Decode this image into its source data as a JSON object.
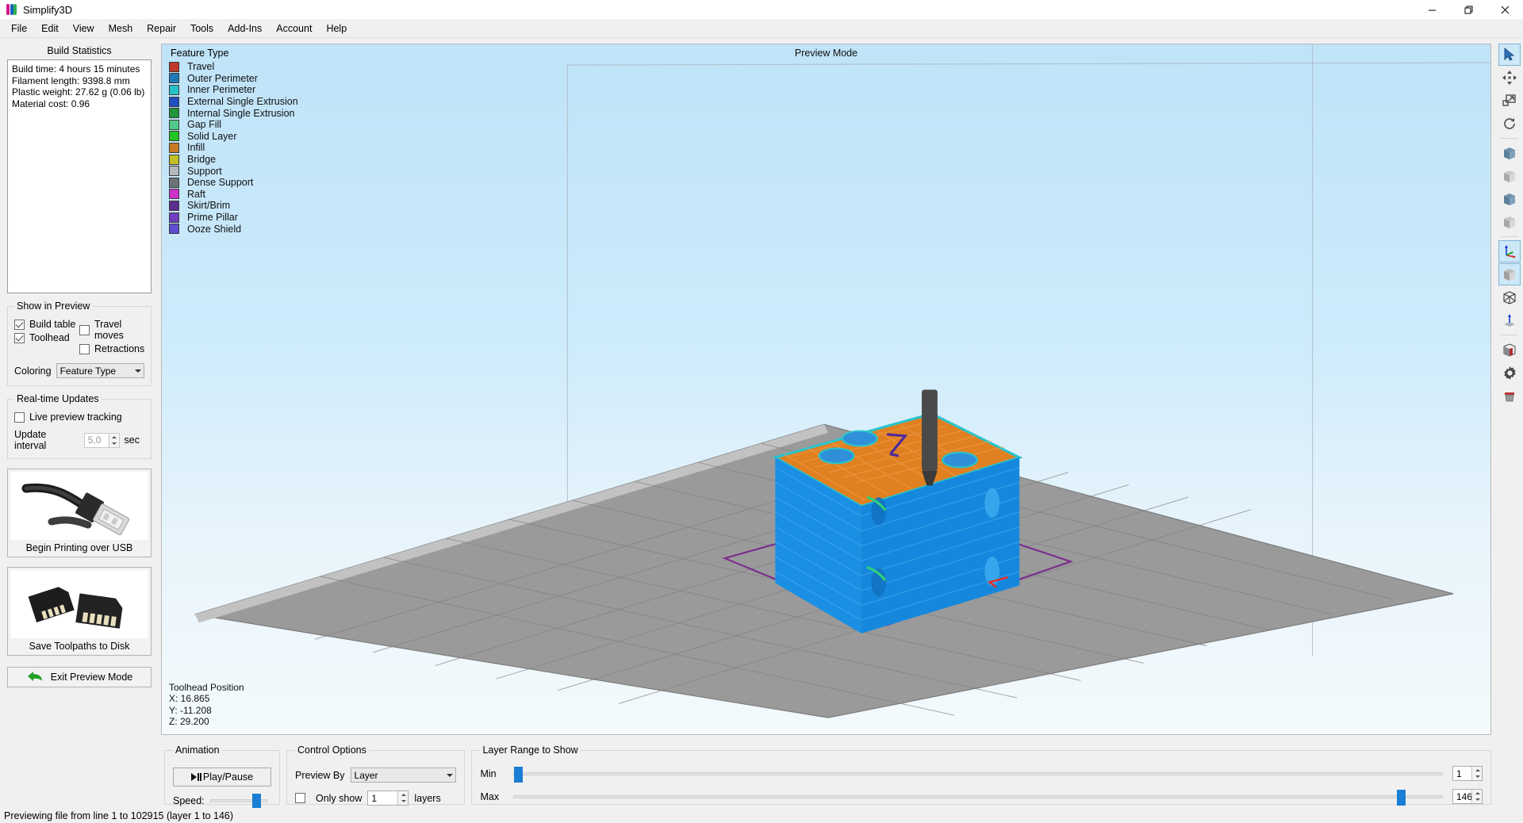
{
  "window": {
    "title": "Simplify3D",
    "logo_icon": "simplify3d-logo",
    "controls": [
      {
        "name": "minimize",
        "glyph": "—"
      },
      {
        "name": "maximize",
        "glyph": "❐"
      },
      {
        "name": "close",
        "glyph": "✕"
      }
    ]
  },
  "menubar": {
    "items": [
      "File",
      "Edit",
      "View",
      "Mesh",
      "Repair",
      "Tools",
      "Add-Ins",
      "Account",
      "Help"
    ]
  },
  "left_panel": {
    "build_statistics": {
      "title": "Build Statistics",
      "lines": [
        "Build time: 4 hours 15 minutes",
        "Filament length: 9398.8 mm",
        "Plastic weight: 27.62 g (0.06 lb)",
        "Material cost: 0.96"
      ]
    },
    "show_in_preview": {
      "legend": "Show in Preview",
      "checkboxes": [
        {
          "label": "Build table",
          "checked": true
        },
        {
          "label": "Travel moves",
          "checked": false
        },
        {
          "label": "Toolhead",
          "checked": true
        },
        {
          "label": "Retractions",
          "checked": false
        }
      ],
      "coloring_label": "Coloring",
      "coloring_value": "Feature Type"
    },
    "realtime_updates": {
      "legend": "Real-time Updates",
      "live_preview_label": "Live preview tracking",
      "live_preview_checked": false,
      "interval_label": "Update interval",
      "interval_value": "5,0",
      "interval_unit": "sec"
    },
    "buttons": {
      "usb_caption": "Begin Printing over USB",
      "usb_icon": "usb-cable-photo",
      "sd_caption": "Save Toolpaths to Disk",
      "sd_icon": "sd-card-photo",
      "exit_caption": "Exit Preview Mode",
      "exit_icon": "back-arrow-icon"
    }
  },
  "viewport": {
    "title": "Preview Mode",
    "legend_title": "Feature Type",
    "legend_items": [
      {
        "label": "Travel",
        "color": "#c0392b"
      },
      {
        "label": "Outer Perimeter",
        "color": "#1f78b4"
      },
      {
        "label": "Inner Perimeter",
        "color": "#27c1c9"
      },
      {
        "label": "External Single Extrusion",
        "color": "#1f4fc0"
      },
      {
        "label": "Internal Single Extrusion",
        "color": "#1f9439"
      },
      {
        "label": "Gap Fill",
        "color": "#4ec98a"
      },
      {
        "label": "Solid Layer",
        "color": "#22c522"
      },
      {
        "label": "Infill",
        "color": "#c77a22"
      },
      {
        "label": "Bridge",
        "color": "#c2bf26"
      },
      {
        "label": "Support",
        "color": "#b3b8bd"
      },
      {
        "label": "Dense Support",
        "color": "#6d7379"
      },
      {
        "label": "Raft",
        "color": "#cc2fcc"
      },
      {
        "label": "Skirt/Brim",
        "color": "#5a2e8c"
      },
      {
        "label": "Prime Pillar",
        "color": "#6f3fbf"
      },
      {
        "label": "Ooze Shield",
        "color": "#5b4ed1"
      }
    ],
    "toolhead_position": {
      "title": "Toolhead Position",
      "x": "X: 16.865",
      "y": "Y: -11.208",
      "z": "Z: 29.200"
    }
  },
  "bottom": {
    "animation": {
      "legend": "Animation",
      "play_label": "Play/Pause",
      "speed_label": "Speed:",
      "speed_percent": 88
    },
    "control_options": {
      "legend": "Control Options",
      "preview_by_label": "Preview By",
      "preview_by_value": "Layer",
      "only_show_label": "Only show",
      "only_show_checked": false,
      "only_show_value": "1",
      "layers_label": "layers"
    },
    "layer_range": {
      "legend": "Layer Range to Show",
      "min_label": "Min",
      "min_value": "1",
      "min_percent": 0,
      "max_label": "Max",
      "max_value": "146",
      "max_percent": 96
    }
  },
  "right_toolbar": {
    "items": [
      {
        "name": "select-tool-icon",
        "active": true
      },
      {
        "name": "move-tool-icon",
        "active": false
      },
      {
        "name": "scale-tool-icon",
        "active": false
      },
      {
        "name": "rotate-tool-icon",
        "active": false
      },
      {
        "name": "view-front-icon",
        "active": false
      },
      {
        "name": "view-back-icon",
        "active": false
      },
      {
        "name": "view-left-icon",
        "active": false
      },
      {
        "name": "view-right-icon",
        "active": false
      },
      {
        "name": "axes-origin-icon",
        "active": true
      },
      {
        "name": "view-iso-icon",
        "active": true
      },
      {
        "name": "wireframe-icon",
        "active": false
      },
      {
        "name": "normal-axis-icon",
        "active": false
      },
      {
        "name": "cross-section-icon",
        "active": false
      },
      {
        "name": "settings-gear-icon",
        "active": false
      },
      {
        "name": "delete-model-icon",
        "active": false
      }
    ]
  },
  "statusbar": {
    "text": "Previewing file from line 1 to 102915 (layer 1 to 146)"
  }
}
